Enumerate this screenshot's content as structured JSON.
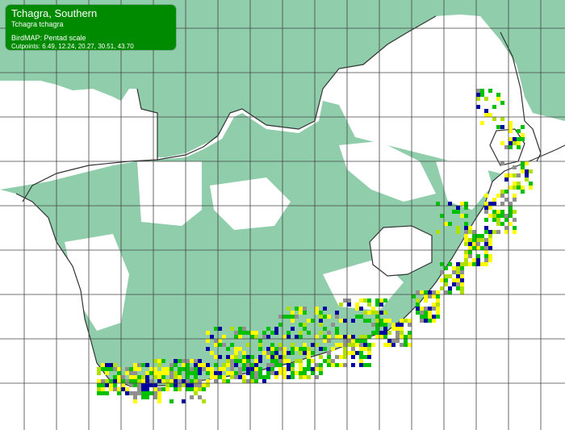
{
  "legend": {
    "common_name": "Tchagra, Southern",
    "scientific_name": "Tchagra tchagra",
    "scale_label": "BirdMAP: Pentad scale",
    "cutpoints_label": "Cutpoints: 6.49, 12.24, 20.27, 30.51, 43.70"
  },
  "colors": {
    "surveyed": "#8fcdab",
    "land": "#ffffff",
    "border": "#333333",
    "grid": "#444444",
    "legend_bg": "#008a00",
    "class_1": "#ffff00",
    "class_2": "#b0e000",
    "class_3": "#00c000",
    "class_4": "#909090",
    "class_5": "#0000a0"
  },
  "map": {
    "type": "species-distribution-pentad-map",
    "region": "South Africa, Lesotho, Swaziland",
    "species_range": "southern and eastern coastal belt"
  }
}
